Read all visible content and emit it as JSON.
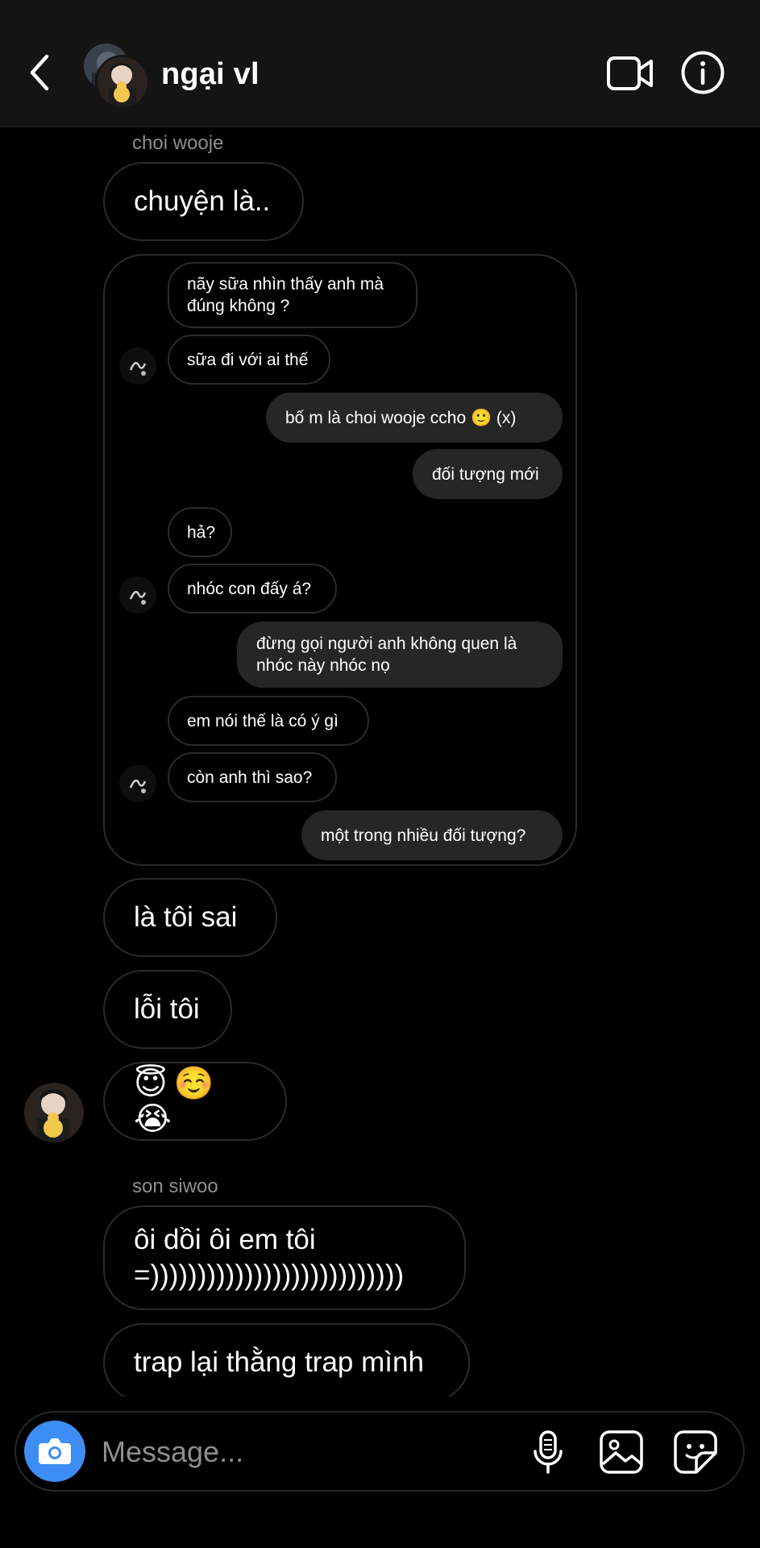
{
  "header": {
    "title": "ngại vl",
    "back_icon": "chevron-left-icon",
    "video_icon": "video-call-icon",
    "info_icon": "info-icon"
  },
  "thread": {
    "sender_1": "choi wooje",
    "msg_1": "chuyện là..",
    "quoted": {
      "q1": "nãy sữa nhìn thấy anh mà\nđúng không ?",
      "q2": "sữa đi với ai thế",
      "q3": "bố m là choi wooje ccho 🙂 (x)",
      "q4": "đối tượng mới",
      "q5": "hả?",
      "q6": "nhóc con đấy á?",
      "q7": "đừng gọi người anh không quen là\nnhóc này nhóc nọ",
      "q8": "em nói thế là có ý gì",
      "q9": "còn anh thì sao?",
      "q10": "một trong nhiều đối tượng?"
    },
    "msg_2": "là tôi sai",
    "msg_3": "lỗi tôi",
    "msg_4": "😇☺️😭",
    "sender_2": "son siwoo",
    "msg_5": "ôi dồi ôi em tôi\n=)))))))))))))))))))))))))))",
    "msg_6": "trap lại thằng trap mình"
  },
  "composer": {
    "placeholder": "Message...",
    "camera_icon": "camera-icon",
    "mic_icon": "microphone-icon",
    "gallery_icon": "gallery-icon",
    "sticker_icon": "sticker-icon",
    "camera_color": "#3d8df5"
  },
  "colors": {
    "background": "#000000",
    "header": "#141414",
    "bubble_border": "#2b2b2b",
    "outgoing_bubble": "#262626",
    "muted_text": "#8e8e8e"
  }
}
